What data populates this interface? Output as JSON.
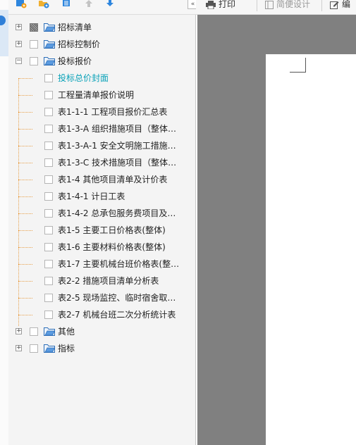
{
  "right_toolbar": {
    "print_label": "打印",
    "design_label": "简便设计",
    "edit_label": "编"
  },
  "tree": {
    "nodes": [
      {
        "label": "招标清单",
        "level": 0,
        "expander": "+",
        "checked": "partial",
        "icon": "folder-icon"
      },
      {
        "label": "招标控制价",
        "level": 0,
        "expander": "+",
        "checked": "none",
        "icon": "folder-icon"
      },
      {
        "label": "投标报价",
        "level": 0,
        "expander": "−",
        "checked": "none",
        "icon": "folder-icon"
      },
      {
        "label": "投标总价封面",
        "level": 1,
        "checked": "none",
        "active": true
      },
      {
        "label": "工程量清单报价说明",
        "level": 1,
        "checked": "none"
      },
      {
        "label": "表1-1-1 工程项目报价汇总表",
        "level": 1,
        "checked": "none"
      },
      {
        "label": "表1-3-A 组织措施项目（整体…",
        "level": 1,
        "checked": "none"
      },
      {
        "label": "表1-3-A-1 安全文明施工措施…",
        "level": 1,
        "checked": "none"
      },
      {
        "label": "表1-3-C 技术措施项目（整体…",
        "level": 1,
        "checked": "none"
      },
      {
        "label": "表1-4 其他项目清单及计价表",
        "level": 1,
        "checked": "none"
      },
      {
        "label": "表1-4-1 计日工表",
        "level": 1,
        "checked": "none"
      },
      {
        "label": "表1-4-2 总承包服务费项目及…",
        "level": 1,
        "checked": "none"
      },
      {
        "label": "表1-5 主要工日价格表(整体)",
        "level": 1,
        "checked": "none"
      },
      {
        "label": "表1-6 主要材料价格表(整体)",
        "level": 1,
        "checked": "none"
      },
      {
        "label": "表1-7 主要机械台班价格表(整…",
        "level": 1,
        "checked": "none"
      },
      {
        "label": "表2-2 措施项目清单分析表",
        "level": 1,
        "checked": "none"
      },
      {
        "label": "表2-5 现场监控、临时宿舍取…",
        "level": 1,
        "checked": "none"
      },
      {
        "label": "表2-7 机械台班二次分析统计表",
        "level": 1,
        "checked": "none"
      },
      {
        "label": "其他",
        "level": 0,
        "expander": "+",
        "checked": "none",
        "icon": "folder-icon"
      },
      {
        "label": "指标",
        "level": 0,
        "expander": "+",
        "checked": "none",
        "icon": "folder-icon"
      }
    ]
  },
  "colors": {
    "active_item": "#0aa2b8",
    "guide_line": "#e8a04a",
    "preview_bg": "#808080"
  }
}
